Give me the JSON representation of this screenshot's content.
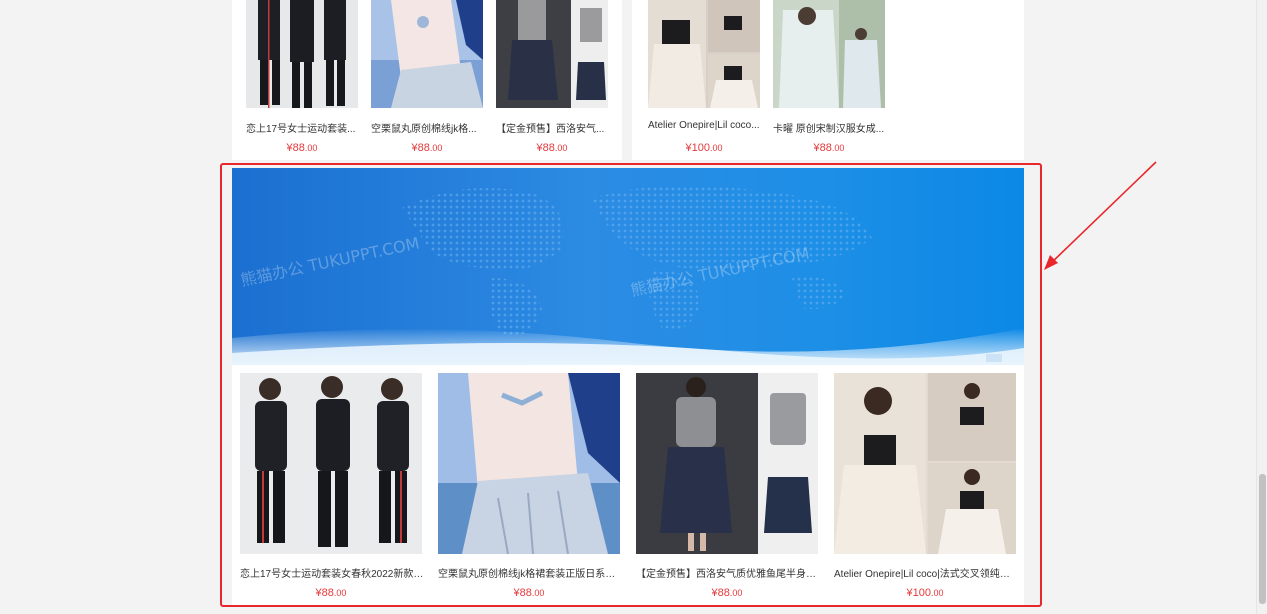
{
  "top_products": [
    {
      "title": "恋上17号女士运动套装...",
      "price_int": "88",
      "price_dec": ".00"
    },
    {
      "title": "空栗鼠丸原创棉线jk格...",
      "price_int": "88",
      "price_dec": ".00"
    },
    {
      "title": "【定金预售】西洛安气...",
      "price_int": "88",
      "price_dec": ".00"
    },
    {
      "title": "Atelier Onepire|Lil coco...",
      "price_int": "100",
      "price_dec": ".00"
    },
    {
      "title": "卡曜 原创宋制汉服女成...",
      "price_int": "88",
      "price_dec": ".00"
    }
  ],
  "currency": "¥",
  "banner": {
    "watermark_1": "熊猫办公 TUKUPPT.COM",
    "watermark_2": "熊猫办公 TUKUPPT.COM"
  },
  "products": [
    {
      "title": "恋上17号女士运动套装女春秋2022新款洋...",
      "price_int": "88",
      "price_dec": ".00"
    },
    {
      "title": "空栗鼠丸原创棉线jk格裙套装正版日系学院...",
      "price_int": "88",
      "price_dec": ".00"
    },
    {
      "title": "【定金预售】西洛安气质优雅鱼尾半身裙...",
      "price_int": "88",
      "price_dec": ".00"
    },
    {
      "title": "Atelier Onepire|Lil coco|法式交叉领纯欲...",
      "price_int": "100",
      "price_dec": ".00"
    }
  ],
  "colors": {
    "price": "#e4393c",
    "highlight": "#e8262c",
    "banner_blue": "#1d8fe6"
  }
}
